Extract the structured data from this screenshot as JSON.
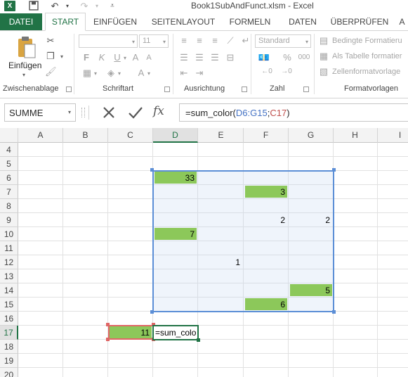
{
  "window": {
    "title": "Book1SubAndFunct.xlsm - Excel"
  },
  "qat": {
    "excel_icon": "excel-logo",
    "save_icon": "save-icon",
    "undo_icon": "undo-icon",
    "redo_icon": "redo-icon"
  },
  "tabs": [
    {
      "label": "DATEI"
    },
    {
      "label": "START"
    },
    {
      "label": "EINFÜGEN"
    },
    {
      "label": "SEITENLAYOUT"
    },
    {
      "label": "FORMELN"
    },
    {
      "label": "DATEN"
    },
    {
      "label": "ÜBERPRÜFEN"
    },
    {
      "label": "A"
    }
  ],
  "ribbon": {
    "clipboard": {
      "paste_label": "Einfügen",
      "group_label": "Zwischenablage"
    },
    "font": {
      "font_name": "",
      "font_size": "11",
      "bold": "F",
      "italic": "K",
      "underline": "U",
      "grow": "A",
      "shrink": "A",
      "font_color": "A",
      "group_label": "Schriftart"
    },
    "alignment": {
      "group_label": "Ausrichtung"
    },
    "number": {
      "format": "Standard",
      "percent": "%",
      "thousands": "000",
      "group_label": "Zahl"
    },
    "styles": {
      "conditional": "Bedingte Formatieru",
      "as_table": "Als Tabelle formatier",
      "cell_styles": "Zellenformatvorlage",
      "group_label": "Formatvorlagen"
    }
  },
  "formula_bar": {
    "name_box": "SUMME",
    "fx": "fx",
    "formula_prefix": "=sum_color(",
    "formula_range": "D6:G15",
    "formula_sep": ";",
    "formula_crit": "C17",
    "formula_suffix": ")"
  },
  "sheet": {
    "columns": [
      "A",
      "B",
      "C",
      "D",
      "E",
      "F",
      "G",
      "H",
      "I"
    ],
    "selected_column": "D",
    "rows": [
      "4",
      "5",
      "6",
      "7",
      "8",
      "9",
      "10",
      "11",
      "12",
      "13",
      "14",
      "15",
      "16",
      "17",
      "18",
      "19",
      "20"
    ],
    "selected_row": "17",
    "fill_color": "#8cc85a",
    "cells": {
      "D6": "33",
      "F7": "3",
      "F9": "2",
      "G9": "2",
      "D10": "7",
      "E12": "1",
      "G14": "5",
      "F15": "6",
      "C17": "11",
      "D17": "=sum_colo"
    },
    "highlighted_range": "D6:G15",
    "criteria_cell": "C17",
    "active_cell": "D17"
  }
}
